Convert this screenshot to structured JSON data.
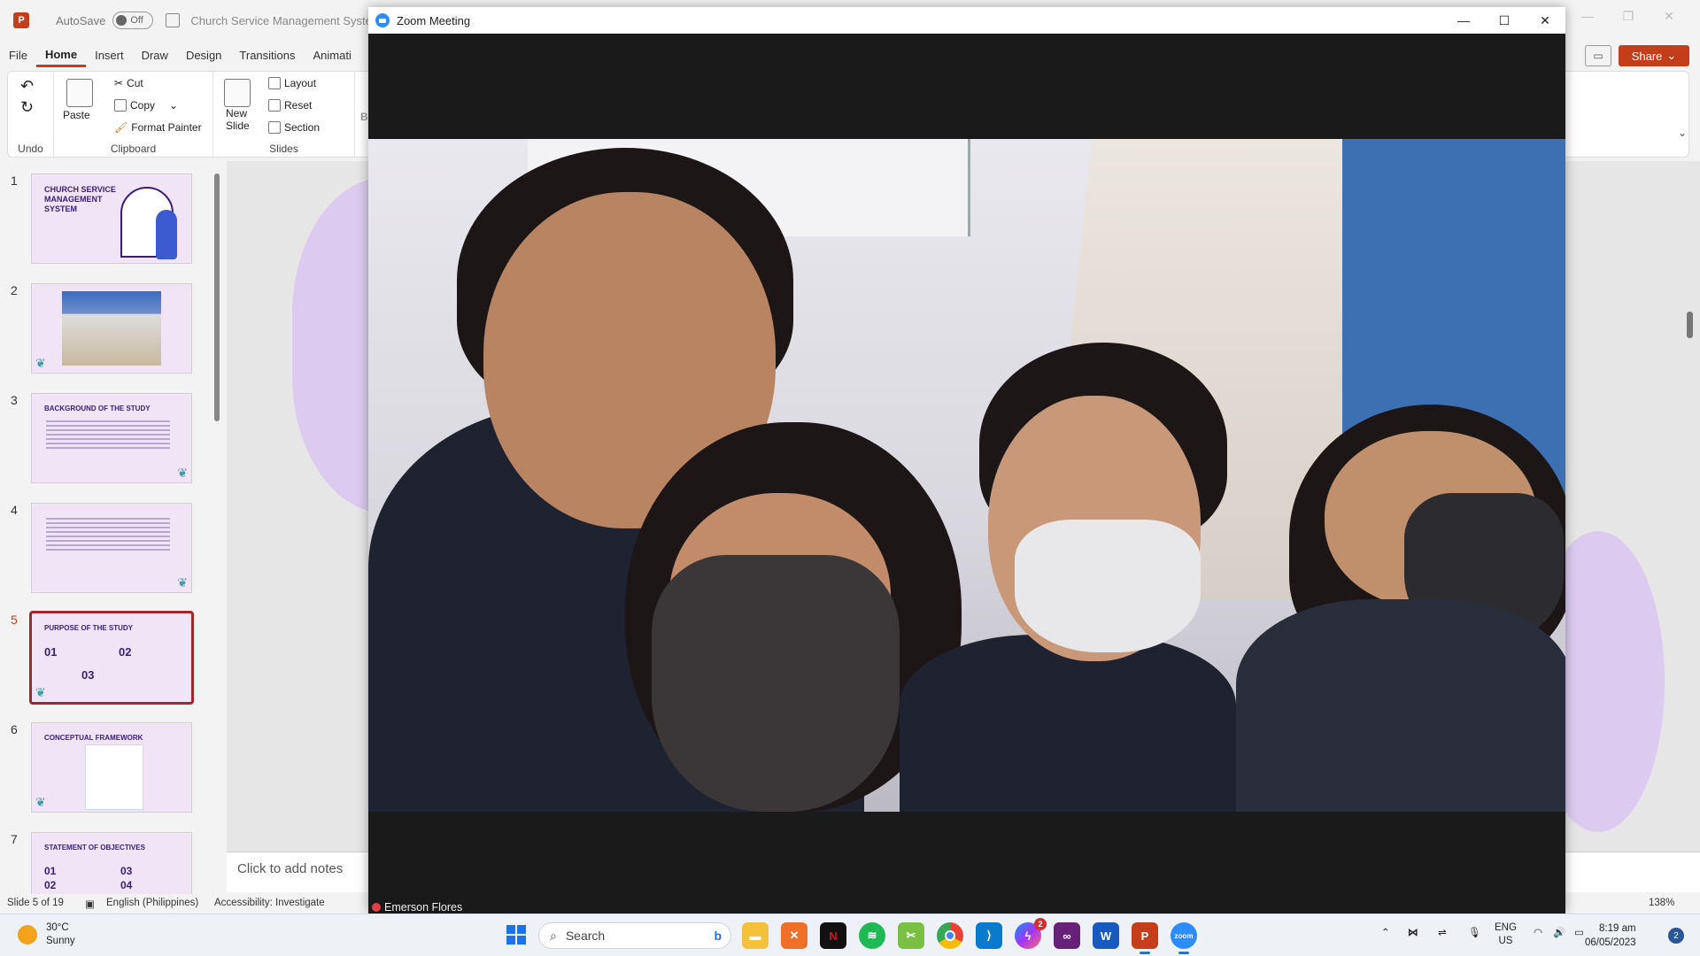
{
  "ppt": {
    "app_icon": "P",
    "autosave_label": "AutoSave",
    "autosave_state": "Off",
    "doc_title": "Church Service Management System Thes",
    "tabs": [
      "File",
      "Home",
      "Insert",
      "Draw",
      "Design",
      "Transitions",
      "Animati"
    ],
    "active_tab": "Home",
    "share_label": "Share",
    "ribbon": {
      "undo_label": "Undo",
      "paste_label": "Paste",
      "cut_label": "Cut",
      "copy_label": "Copy",
      "format_painter_label": "Format Painter",
      "clipboard_label": "Clipboard",
      "new_slide_label": "New",
      "new_slide_label2": "Slide",
      "layout_label": "Layout",
      "reset_label": "Reset",
      "section_label": "Section",
      "slides_label": "Slides",
      "bold_label": "B"
    },
    "thumbnails": [
      {
        "num": "1",
        "title": "CHURCH SERVICE MANAGEMENT SYSTEM"
      },
      {
        "num": "2",
        "title": ""
      },
      {
        "num": "3",
        "title": "BACKGROUND OF THE STUDY"
      },
      {
        "num": "4",
        "title": ""
      },
      {
        "num": "5",
        "title": "PURPOSE OF THE STUDY",
        "n1": "01",
        "n2": "02",
        "n3": "03"
      },
      {
        "num": "6",
        "title": "CONCEPTUAL FRAMEWORK"
      },
      {
        "num": "7",
        "title": "STATEMENT OF OBJECTIVES",
        "n1": "01",
        "n2": "02",
        "n3": "03",
        "n4": "04"
      }
    ],
    "active_slide": "5",
    "notes_placeholder": "Click to add notes",
    "status": {
      "slide_count": "Slide 5 of 19",
      "language": "English (Philippines)",
      "accessibility": "Accessibility: Investigate",
      "zoom": "138%"
    }
  },
  "zoom": {
    "window_title": "Zoom Meeting",
    "participant_name": "Emerson Flores"
  },
  "taskbar": {
    "weather_temp": "30°C",
    "weather_desc": "Sunny",
    "search_placeholder": "Search",
    "apps": [
      "file-explorer",
      "xampp",
      "netflix",
      "spotify",
      "snipping-tool",
      "chrome",
      "vscode",
      "messenger",
      "visual-studio",
      "word",
      "powerpoint",
      "zoom"
    ],
    "messenger_badge": "2",
    "lang_top": "ENG",
    "lang_bottom": "US",
    "time": "8:19 am",
    "date": "06/05/2023",
    "notification_count": "2"
  },
  "colors": {
    "accent": "#c43e1c",
    "slide_purple": "#f2e4f7",
    "zoom_blue": "#2d8cff"
  }
}
